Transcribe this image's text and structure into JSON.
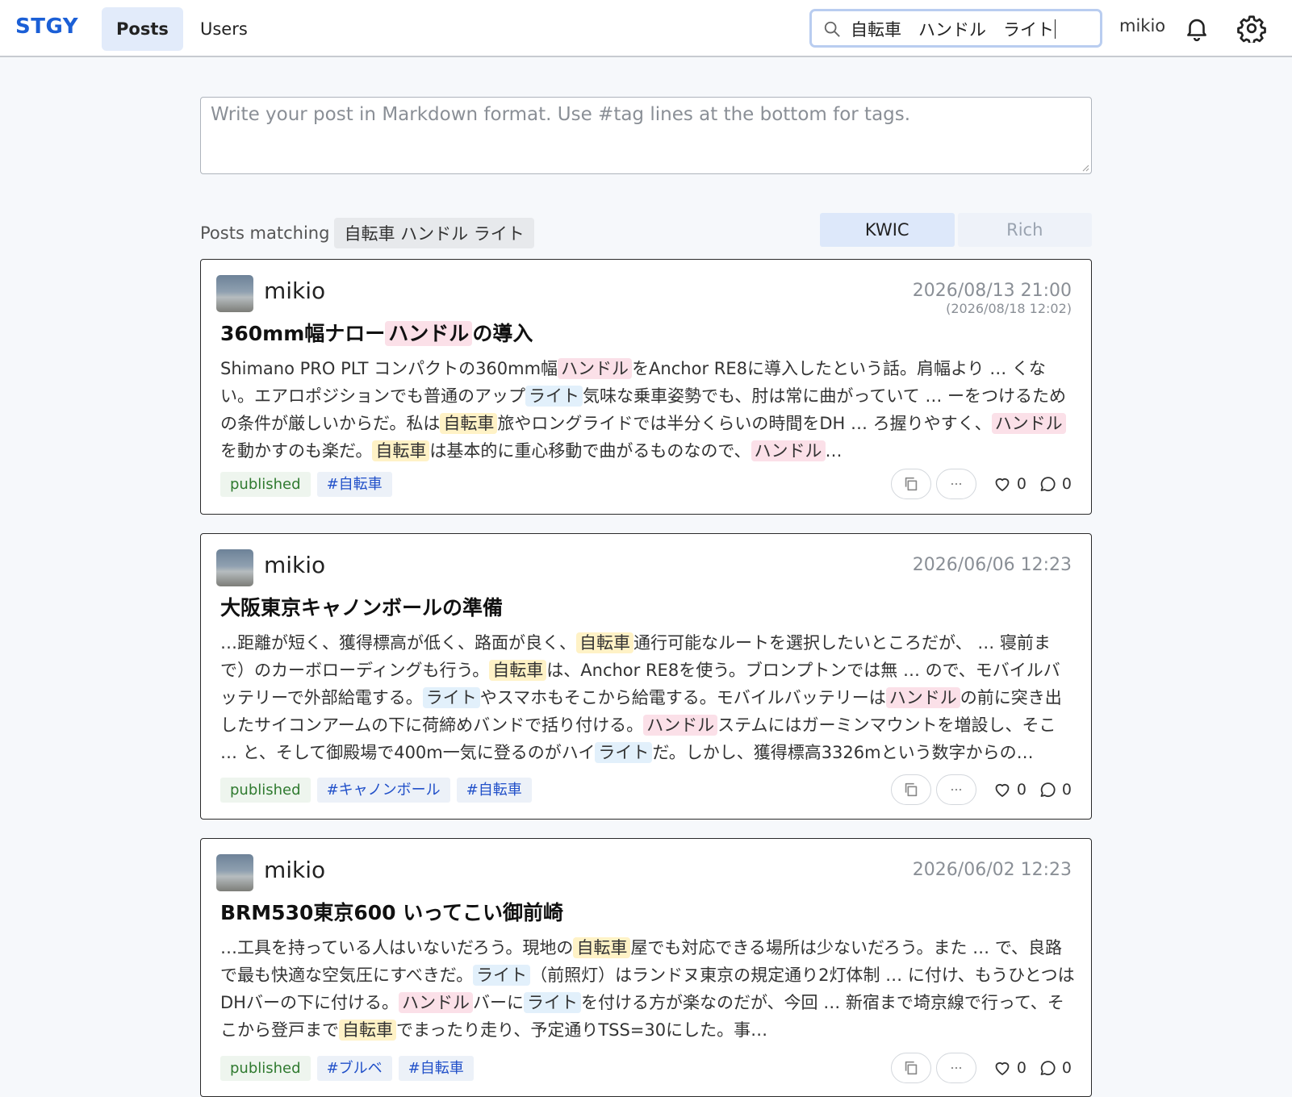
{
  "header": {
    "logo": "STGY",
    "nav": [
      {
        "label": "Posts",
        "active": true
      },
      {
        "label": "Users",
        "active": false
      }
    ],
    "search_value": "自転車　ハンドル　ライト",
    "user": "mikio",
    "icons": [
      "search-icon",
      "bell-icon",
      "gear-icon"
    ]
  },
  "composer": {
    "placeholder": "Write your post in Markdown format. Use #tag lines at the bottom for tags."
  },
  "results": {
    "label": "Posts matching",
    "query": "自転車 ハンドル ライト",
    "modes": [
      "KWIC",
      "Rich"
    ],
    "active_mode": "KWIC"
  },
  "colors": {
    "accent": "#1b5fd6",
    "hl_bicycle": "#fff2c6",
    "hl_handle": "#fbe0e8",
    "hl_light": "#e2f0fb"
  },
  "posts": [
    {
      "author": "mikio",
      "date": "2026/08/13 21:00",
      "updated": "(2026/08/18 12:02)",
      "title": [
        [
          "360mm幅ナロー",
          -1
        ],
        [
          "ハンドル",
          1
        ],
        [
          "の導入",
          -1
        ]
      ],
      "snippet": [
        [
          "Shimano PRO PLT コンパクトの360mm幅",
          -1
        ],
        [
          "ハンドル",
          1
        ],
        [
          "をAnchor RE8に導入したという話。肩幅より … くない。エアロポジションでも普通のアップ",
          -1
        ],
        [
          "ライト",
          2
        ],
        [
          "気味な乗車姿勢でも、肘は常に曲がっていて … ーをつけるための条件が厳しいからだ。私は",
          -1
        ],
        [
          "自転車",
          0
        ],
        [
          "旅やロングライドでは半分くらいの時間をDH … ろ握りやすく、",
          -1
        ],
        [
          "ハンドル",
          1
        ],
        [
          "を動かすのも楽だ。",
          -1
        ],
        [
          "自転車",
          0
        ],
        [
          "は基本的に重心移動で曲がるものなので、",
          -1
        ],
        [
          "ハンドル",
          1
        ],
        [
          "…",
          -1
        ]
      ],
      "tags": [
        "published",
        "#自転車"
      ],
      "likes": "0",
      "comments": "0"
    },
    {
      "author": "mikio",
      "date": "2026/06/06 12:23",
      "updated": "",
      "title": [
        [
          "大阪東京キャノンボールの準備",
          -1
        ]
      ],
      "snippet": [
        [
          "…距離が短く、獲得標高が低く、路面が良く、",
          -1
        ],
        [
          "自転車",
          0
        ],
        [
          "通行可能なルートを選択したいところだが、 … 寝前まで）のカーボローディングも行う。",
          -1
        ],
        [
          "自転車",
          0
        ],
        [
          "は、Anchor RE8を使う。ブロンプトンでは無 … ので、モバイルバッテリーで外部給電する。",
          -1
        ],
        [
          "ライト",
          2
        ],
        [
          "やスマホもそこから給電する。モバイルバッテリーは",
          -1
        ],
        [
          "ハンドル",
          1
        ],
        [
          "の前に突き出したサイコンアームの下に荷締めバンドで括り付ける。",
          -1
        ],
        [
          "ハンドル",
          1
        ],
        [
          "ステムにはガーミンマウントを増設し、そこ … と、そして御殿場で400m一気に登るのがハイ",
          -1
        ],
        [
          "ライト",
          2
        ],
        [
          "だ。しかし、獲得標高3326mという数字からの…",
          -1
        ]
      ],
      "tags": [
        "published",
        "#キャノンボール",
        "#自転車"
      ],
      "likes": "0",
      "comments": "0"
    },
    {
      "author": "mikio",
      "date": "2026/06/02 12:23",
      "updated": "",
      "title": [
        [
          "BRM530東京600 いってこい御前崎",
          -1
        ]
      ],
      "snippet": [
        [
          "…工具を持っている人はいないだろう。現地の",
          -1
        ],
        [
          "自転車",
          0
        ],
        [
          "屋でも対応できる場所は少ないだろう。また … で、良路で最も快適な空気圧にすべきだ。",
          -1
        ],
        [
          "ライト",
          2
        ],
        [
          "（前照灯）はランドヌ東京の規定通り2灯体制 … に付け、もうひとつはDHバーの下に付ける。",
          -1
        ],
        [
          "ハンドル",
          1
        ],
        [
          "バーに",
          -1
        ],
        [
          "ライト",
          2
        ],
        [
          "を付ける方が楽なのだが、今回 … 新宿まで埼京線で行って、そこから登戸まで",
          -1
        ],
        [
          "自転車",
          0
        ],
        [
          "でまったり走り、予定通りTSS=30にした。事…",
          -1
        ]
      ],
      "tags": [
        "published",
        "#ブルベ",
        "#自転車"
      ],
      "likes": "0",
      "comments": "0"
    }
  ]
}
